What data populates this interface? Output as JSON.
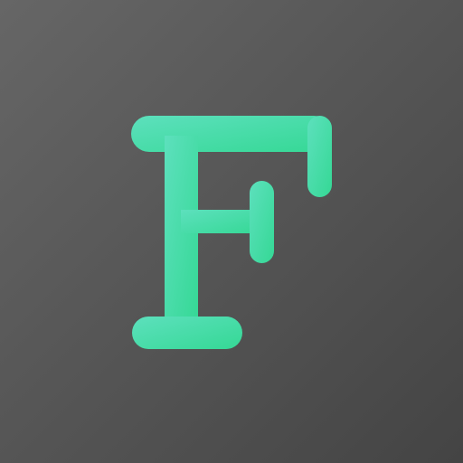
{
  "icon": {
    "name": "app-icon",
    "logo_letter": "F",
    "colors": {
      "background_top_left": "#666666",
      "background_bottom_right": "#444444",
      "glyph_light": "#5de0bd",
      "glyph_dark": "#35d895"
    }
  }
}
